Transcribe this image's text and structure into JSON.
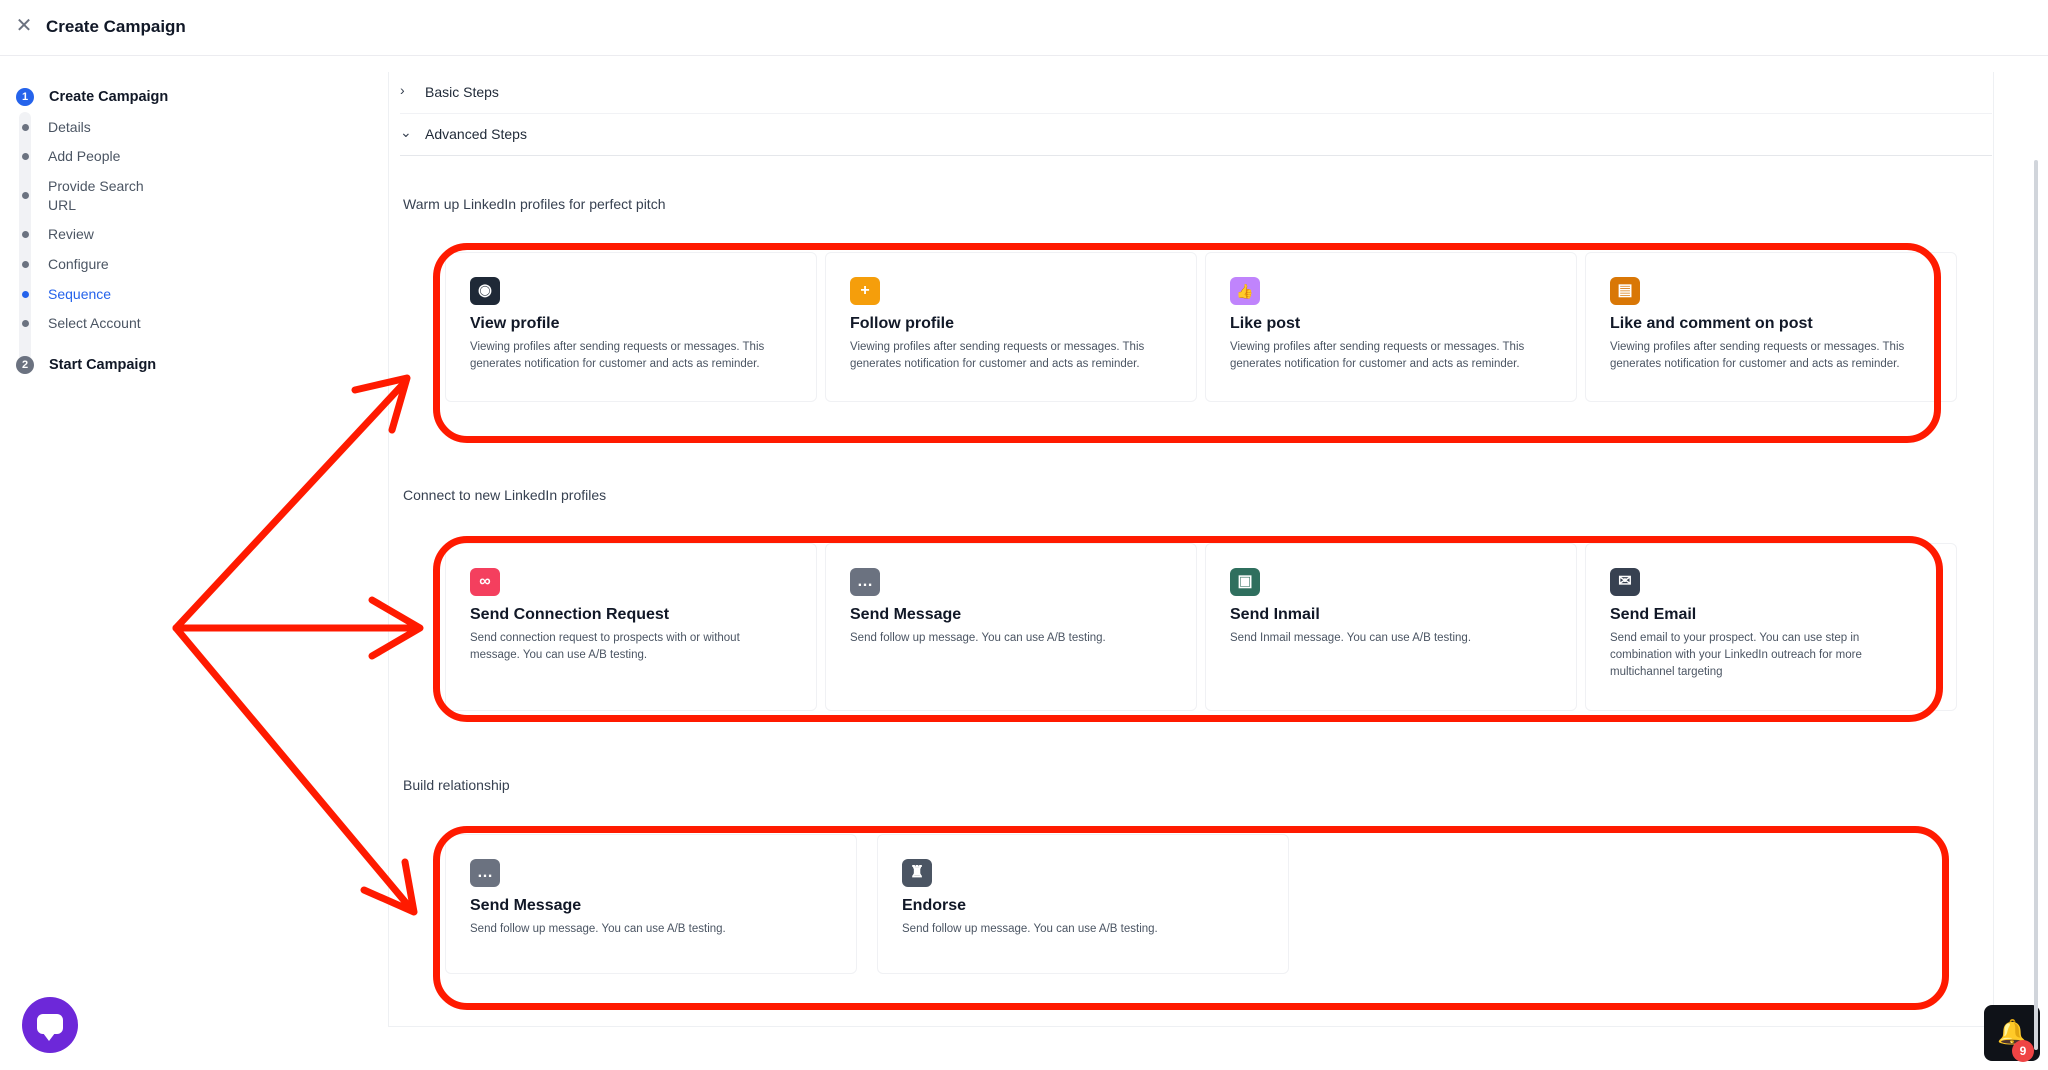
{
  "header": {
    "title": "Create Campaign",
    "close_icon": "close-icon"
  },
  "sidebar": {
    "steps": [
      {
        "number": "1",
        "label": "Create Campaign",
        "color": "#2563eb",
        "substeps": [
          {
            "label": "Details",
            "active": false
          },
          {
            "label": "Add People",
            "active": false
          },
          {
            "label": "Provide Search URL",
            "active": false
          },
          {
            "label": "Review",
            "active": false
          },
          {
            "label": "Configure",
            "active": false
          },
          {
            "label": "Sequence",
            "active": true
          },
          {
            "label": "Select Account",
            "active": false
          }
        ]
      },
      {
        "number": "2",
        "label": "Start Campaign",
        "color": "#6b7280"
      }
    ]
  },
  "accordions": {
    "basic": {
      "label": "Basic Steps",
      "icon": "chevron-right-icon"
    },
    "advanced": {
      "label": "Advanced Steps",
      "icon": "chevron-down-icon"
    }
  },
  "sections": [
    {
      "title": "Warm up LinkedIn profiles for perfect pitch",
      "cards": [
        {
          "icon": "eye-icon",
          "glyph": "◉",
          "color": "#1f2937",
          "title": "View profile",
          "desc": "Viewing profiles after sending requests or messages. This generates notification for customer and acts as reminder."
        },
        {
          "icon": "plus-icon",
          "glyph": "+",
          "color": "#f59e0b",
          "title": "Follow profile",
          "desc": "Viewing profiles after sending requests or messages. This generates notification for customer and acts as reminder."
        },
        {
          "icon": "thumbs-up-icon",
          "glyph": "👍",
          "color": "#c084fc",
          "title": "Like post",
          "desc": "Viewing profiles after sending requests or messages. This generates notification for customer and acts as reminder."
        },
        {
          "icon": "comment-icon",
          "glyph": "▤",
          "color": "#d97706",
          "title": "Like and comment on post",
          "desc": "Viewing profiles after sending requests or messages. This generates notification for customer and acts as reminder."
        }
      ]
    },
    {
      "title": "Connect to new LinkedIn profiles",
      "cards": [
        {
          "icon": "link-icon",
          "glyph": "∞",
          "color": "#f43f5e",
          "title": "Send Connection Request",
          "desc": "Send connection request to prospects with or without message. You can use A/B testing."
        },
        {
          "icon": "chat-icon",
          "glyph": "…",
          "color": "#6b7280",
          "title": "Send Message",
          "desc": "Send follow up message. You can use A/B testing."
        },
        {
          "icon": "inmail-icon",
          "glyph": "▣",
          "color": "#2f6f5e",
          "title": "Send Inmail",
          "desc": "Send Inmail message. You can use A/B testing."
        },
        {
          "icon": "envelope-icon",
          "glyph": "✉",
          "color": "#374151",
          "title": "Send Email",
          "desc": "Send email to your prospect. You can use step in combination with your LinkedIn outreach for more multichannel targeting"
        }
      ]
    },
    {
      "title": "Build relationship",
      "cards": [
        {
          "icon": "chat-icon",
          "glyph": "…",
          "color": "#6b7280",
          "title": "Send Message",
          "desc": "Send follow up message. You can use A/B testing."
        },
        {
          "icon": "trophy-icon",
          "glyph": "♜",
          "color": "#4b5563",
          "title": "Endorse",
          "desc": "Send follow up message. You can use A/B testing."
        }
      ]
    }
  ],
  "notifications": {
    "count": "9"
  },
  "colors": {
    "highlight": "#ff1a00",
    "active_step": "#2563eb",
    "chat_button": "#6d28d9"
  }
}
